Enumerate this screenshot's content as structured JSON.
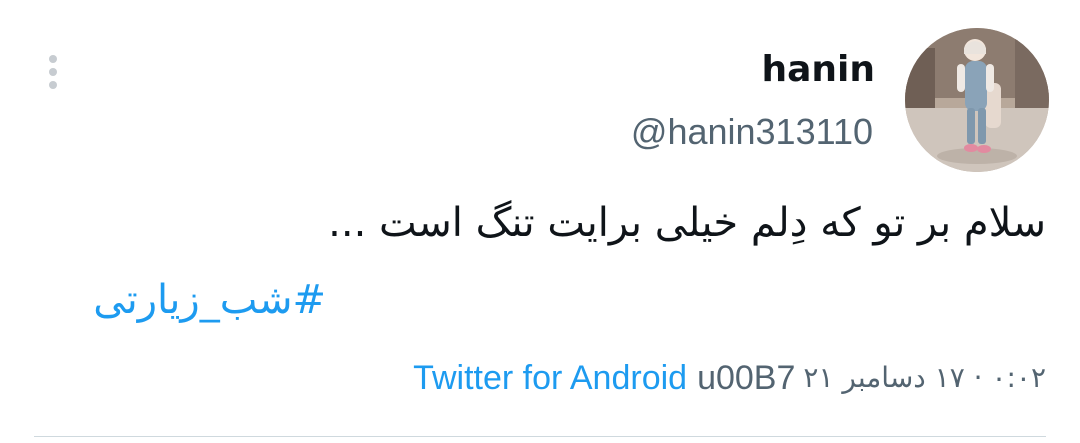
{
  "tweet": {
    "author": {
      "display_name": "hanin",
      "handle": "@hanin313110",
      "avatar_icon": "profile-photo-child"
    },
    "text": "سلام بر تو که دِلم خیلی برایت تنگ است ...",
    "hashtag": "#شب_زیارتی",
    "timestamp": "۰:۰۲ · ۱۷ دسامبر ۲۱",
    "source_separator": "u00B7",
    "source": "Twitter for Android",
    "menu_icon": "more-vertical-icon"
  },
  "colors": {
    "link": "#1d9bf0",
    "secondary_text": "#536471",
    "primary_text": "#0f1419",
    "divider": "#cfd9de",
    "menu_dots": "#c7ccd1"
  }
}
